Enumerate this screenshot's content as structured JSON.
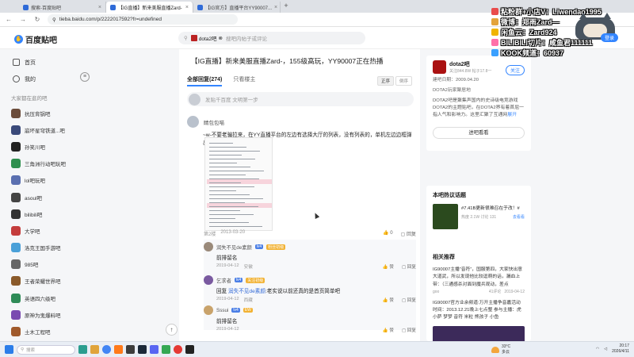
{
  "browser": {
    "tabs": [
      {
        "label": "搜索-百度贴吧",
        "active": false
      },
      {
        "label": "【IG直播】新来美服直播Zard-",
        "active": true
      },
      {
        "label": "【IG官方】直播平台YY90007...",
        "active": false
      }
    ],
    "url": "tieba.baidu.com/p/2222017592?fr=undefined"
  },
  "header": {
    "logo": "百度贴吧",
    "search_forum": "dota2吧",
    "search_placeholder": "搜吧内帖子或评论"
  },
  "sidebar": {
    "nav": [
      {
        "label": "首页",
        "icon": "home-icon"
      },
      {
        "label": "我的",
        "icon": "user-icon"
      }
    ],
    "section_title": "大家都在逛的吧",
    "forums": [
      {
        "label": "抗压背锅吧",
        "color": "#6b4c3b"
      },
      {
        "label": "崩坏星穹铁道...吧",
        "color": "#3a4a7a"
      },
      {
        "label": "孙笑川吧",
        "color": "#222222"
      },
      {
        "label": "三角洲行动吧玩吧",
        "color": "#2f8f4f"
      },
      {
        "label": "lol吧玩吧",
        "color": "#5a6fb0"
      },
      {
        "label": "asoul吧",
        "color": "#444444"
      },
      {
        "label": "bilibili吧",
        "color": "#333333"
      },
      {
        "label": "大学吧",
        "color": "#c43c3c"
      },
      {
        "label": "洛克王国手游吧",
        "color": "#4aa0d8"
      },
      {
        "label": "985吧",
        "color": "#666666"
      },
      {
        "label": "王者荣耀世界吧",
        "color": "#8a5a2a"
      },
      {
        "label": "英语四六级吧",
        "color": "#2e8b57"
      },
      {
        "label": "原神为鬼爆料吧",
        "color": "#7a4ab0"
      },
      {
        "label": "土木工程吧",
        "color": "#a05a2c"
      }
    ]
  },
  "post": {
    "title": "【IG直播】新来美服直播Zard-，155级高玩，YY90007正在热播",
    "tabs": [
      "全部回复(274)",
      "只看楼主"
    ],
    "sort": [
      "正序",
      "倒序"
    ],
    "reply_placeholder": "发贴千百度 文明第一步",
    "floor": {
      "user": "睛包包喵",
      "text": "~w-不要老骗拉来，在YY直播平台的左边有选择大厅的列表，没有列表的，单机左边边框弹出~~",
      "meta_floor": "第2楼",
      "meta_date": "2013-03-20",
      "likes": "0",
      "reply_label": "回复"
    },
    "subreplies": [
      {
        "user": "润失不见de素颜",
        "badge1": "lv4",
        "badge2": "粉丝初级",
        "text": "前排留名",
        "date": "2019-04-12",
        "location": "安徽",
        "like_label": "赞",
        "reply_label": "回复",
        "color": "#9a8a7a"
      },
      {
        "user": "乞求者",
        "badge1": "lv4",
        "badge2": "关注初级",
        "mention": "润失不见de素颜",
        "text_prefix": "回复 ",
        "text": ":老实说以前还真的是首页简单吧",
        "date": "2019-04-12",
        "location": "西藏",
        "like_label": "赞",
        "reply_label": "回复",
        "color": "#7a5aa0"
      },
      {
        "user": "Sssui",
        "badge1": "lv4",
        "badge2": "EW",
        "text": "前排留名",
        "date": "2019-04-12",
        "location": "",
        "like_label": "赞",
        "reply_label": "回复",
        "color": "#c9a36b"
      }
    ]
  },
  "right": {
    "forum": {
      "name": "dota2吧",
      "stats": "关注844.8W  帖子17.8一",
      "follow": "关注",
      "created": "建吧日期：2009.04.20",
      "rank": "DOTA2玩家聚居地",
      "desc": "DOTA2吧是聚集声国内的史诗级电竞游戏DOTA2的主题贴吧，在DOTA2界有着首屈一指人气和影响力。这里汇聚了互通网",
      "more": "展开",
      "enter": "进吧看看"
    },
    "hot": {
      "title": "本吧热议话题",
      "item": "#7.41B更新很难召在于改！#",
      "stat": "热度 2.1W   讨论 131",
      "link": "去看看"
    },
    "rec": {
      "title": "相关推荐",
      "items": [
        {
          "text": "IG90007主播“音符”，国服第四，大家快出意大道武，所以发现他比较逗萌的话，漏血上带：（三通感杀对面到魔兵观动，差点",
          "meta_user": "goo",
          "meta_replies": "41评论",
          "meta_date": "2019-04-12"
        },
        {
          "text": "IG90007官方业余频道:万开主播争音嘉活动时间：2013.12.21晚上七点整 参与主播：虎小萨 梦梦 音符 米粒 熊孩子 小鱼",
          "meta_user": "",
          "meta_replies": "",
          "meta_date": ""
        }
      ]
    }
  },
  "overlay": {
    "lines": [
      {
        "text": "粘粉群+小店V：Liwendao1995",
        "color": "#e94c4c"
      },
      {
        "text": "微博：郑雨Zard—",
        "color": "#e3a33a"
      },
      {
        "text": "闲鱼云：Zard924",
        "color": "#f0b400"
      },
      {
        "text": "BILIBILI切片：咸鱼君111111",
        "color": "#ff6fa8"
      },
      {
        "text": "KOOK频道：60937",
        "color": "#3aa0ff"
      }
    ],
    "login": "登录"
  },
  "taskbar": {
    "search_placeholder": "搜索",
    "weather_temp": "33°C",
    "weather_desc": "多云",
    "time": "20:17",
    "date": "2026/4/11"
  }
}
